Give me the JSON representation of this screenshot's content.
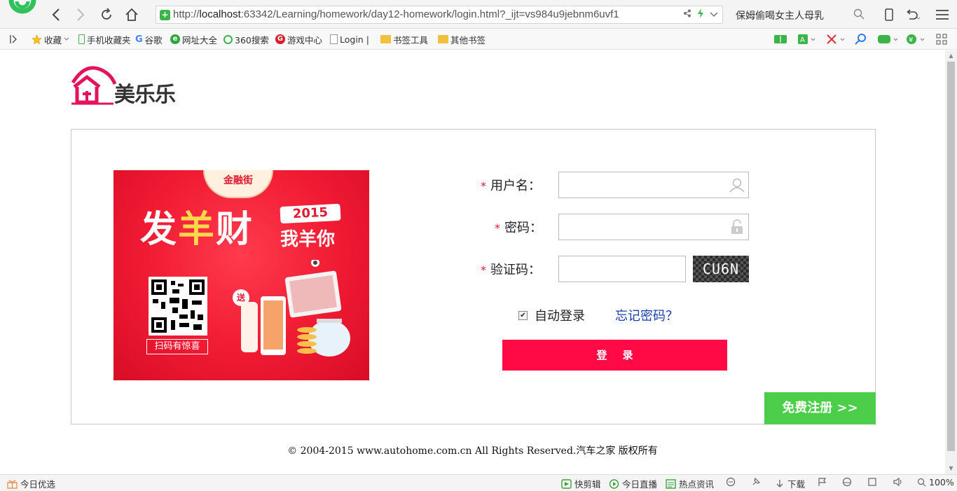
{
  "browser": {
    "url_prefix": "http://",
    "url_host": "localhost",
    "url_rest": ":63342/Learning/homework/day12-homework/login.html?_ijt=vs984u9jebnm6uvf1",
    "search_text": "保姆偷喝女主人母乳"
  },
  "bookmarks": [
    {
      "label": "收藏"
    },
    {
      "label": "手机收藏夹"
    },
    {
      "label": "谷歌"
    },
    {
      "label": "网址大全"
    },
    {
      "label": "360搜索"
    },
    {
      "label": "游戏中心"
    },
    {
      "label": "Login |"
    },
    {
      "label": "书签工具"
    },
    {
      "label": "其他书签"
    }
  ],
  "logo": {
    "text": "美乐乐",
    "brand_color": "#e3145c"
  },
  "promo": {
    "tag": "金融街",
    "title_1": "发",
    "title_2": "羊",
    "title_3": "财",
    "year": "2015",
    "subtitle": "我羊你",
    "gift": "送",
    "qr_caption": "扫码有惊喜"
  },
  "form": {
    "username_label": "用户名：",
    "password_label": "密码：",
    "captcha_label": "验证码：",
    "required_mark": "*",
    "username_value": "",
    "password_value": "",
    "captcha_value": "",
    "captcha_image_text": "CU6N",
    "auto_login_label": "自动登录",
    "auto_login_checked": true,
    "forgot_label": "忘记密码？",
    "login_button": "登录",
    "register_button": "免费注册 >>",
    "login_color": "#ff0a45",
    "register_color": "#4cce4a"
  },
  "footer": {
    "text": "© 2004-2015 www.autohome.com.cn All Rights Reserved.汽车之家 版权所有"
  },
  "status_bar": {
    "left": "今日优选",
    "items": [
      "快剪辑",
      "今日直播",
      "热点资讯",
      "下载"
    ],
    "zoom": "100%"
  }
}
